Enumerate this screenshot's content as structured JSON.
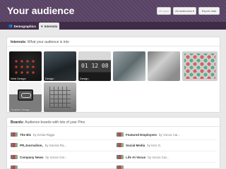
{
  "header": {
    "title": "Your audience",
    "buttons": {
      "all_apps": "All apps",
      "all_audiences": "All audiences",
      "export": "Export data"
    }
  },
  "tabs": [
    {
      "label": "Demographics",
      "icon": "people-icon",
      "active": false
    },
    {
      "label": "Interests",
      "icon": "heart-icon",
      "active": true
    }
  ],
  "interests": {
    "title": "Interests:",
    "subtitle": "What your audience is into",
    "tiles": [
      {
        "label": "Web Design"
      },
      {
        "label": "Design"
      },
      {
        "label": "Design"
      },
      {
        "label": ""
      },
      {
        "label": ""
      },
      {
        "label": ""
      },
      {
        "label": "Graphic Design"
      },
      {
        "label": ""
      }
    ]
  },
  "boards": {
    "title": "Boards:",
    "subtitle": "Audience boards with lots of your Pins",
    "items": [
      {
        "name": "The Biz",
        "by": "by Krista Riggs"
      },
      {
        "name": "Featured Employees",
        "by": "by Vocus Car..."
      },
      {
        "name": "PR,Journalism,",
        "by": "by Karicia Ra..."
      },
      {
        "name": "Social Media",
        "by": "by Ken G."
      },
      {
        "name": "Company News",
        "by": "by Vocus Car..."
      },
      {
        "name": "Life At Vocus",
        "by": "by Vocus Car..."
      },
      {
        "name": "",
        "by": ""
      },
      {
        "name": "",
        "by": ""
      }
    ]
  },
  "colors": {
    "header_bg": "#5b4466",
    "tabbar_bg": "#3f2c47",
    "page_bg": "#e9e9e9"
  }
}
